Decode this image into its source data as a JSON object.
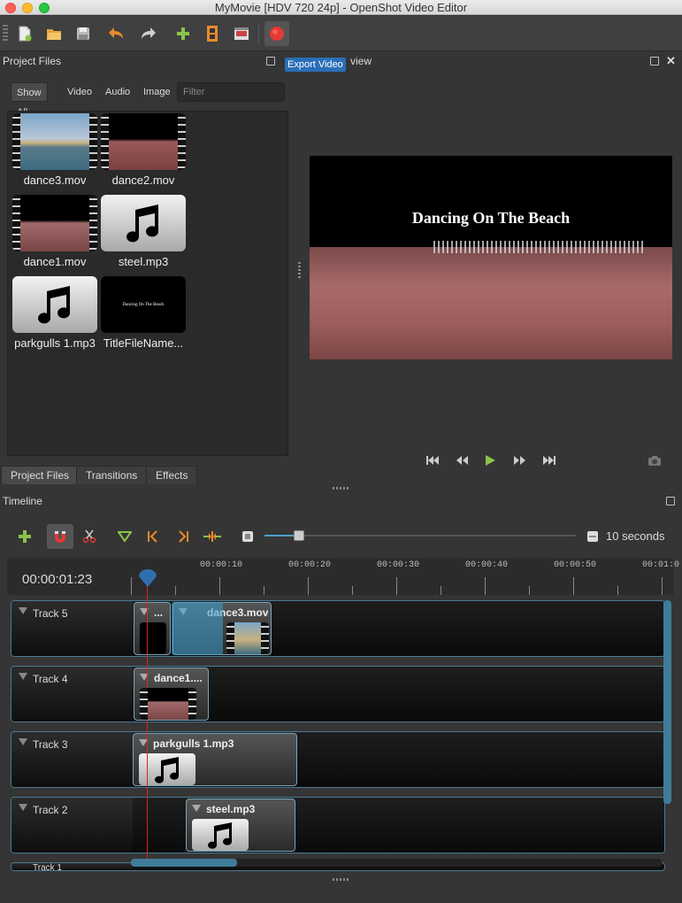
{
  "window": {
    "title": "MyMovie [HDV 720 24p] - OpenShot Video Editor"
  },
  "toolbar": {
    "tooltip": "Export Video"
  },
  "project_files": {
    "header": "Project Files",
    "filters": [
      "Show All",
      "Video",
      "Audio",
      "Image"
    ],
    "filter_placeholder": "Filter",
    "files": [
      {
        "name": "dance3.mov",
        "kind": "video"
      },
      {
        "name": "dance2.mov",
        "kind": "video"
      },
      {
        "name": "dance1.mov",
        "kind": "video"
      },
      {
        "name": "steel.mp3",
        "kind": "audio"
      },
      {
        "name": "parkgulls 1.mp3",
        "kind": "audio"
      },
      {
        "name": "TitleFileName...",
        "kind": "title",
        "thumb_text": "Dancing On The Beach"
      }
    ],
    "tabs": [
      "Project Files",
      "Transitions",
      "Effects"
    ]
  },
  "preview": {
    "header_fragment": "view",
    "title_overlay": "Dancing On The Beach"
  },
  "timeline": {
    "header": "Timeline",
    "zoom_label": "10 seconds",
    "timecode": "00:00:01:23",
    "ruler_labels": [
      "00:00:10",
      "00:00:20",
      "00:00:30",
      "00:00:40",
      "00:00:50",
      "00:01:0"
    ],
    "tracks": [
      {
        "name": "Track 5",
        "clips": [
          {
            "label": "...",
            "type": "title"
          },
          {
            "label": "dance3.mov",
            "type": "video"
          }
        ]
      },
      {
        "name": "Track 4",
        "clips": [
          {
            "label": "dance1....",
            "type": "video"
          }
        ]
      },
      {
        "name": "Track 3",
        "clips": [
          {
            "label": "parkgulls 1.mp3",
            "type": "audio"
          }
        ]
      },
      {
        "name": "Track 2",
        "clips": [
          {
            "label": "steel.mp3",
            "type": "audio"
          }
        ]
      },
      {
        "name": "Track 1",
        "clips": []
      }
    ]
  },
  "colors": {
    "accent": "#3f7c9a",
    "playhead": "#dd2222",
    "tooltip": "#2a6eb8"
  }
}
